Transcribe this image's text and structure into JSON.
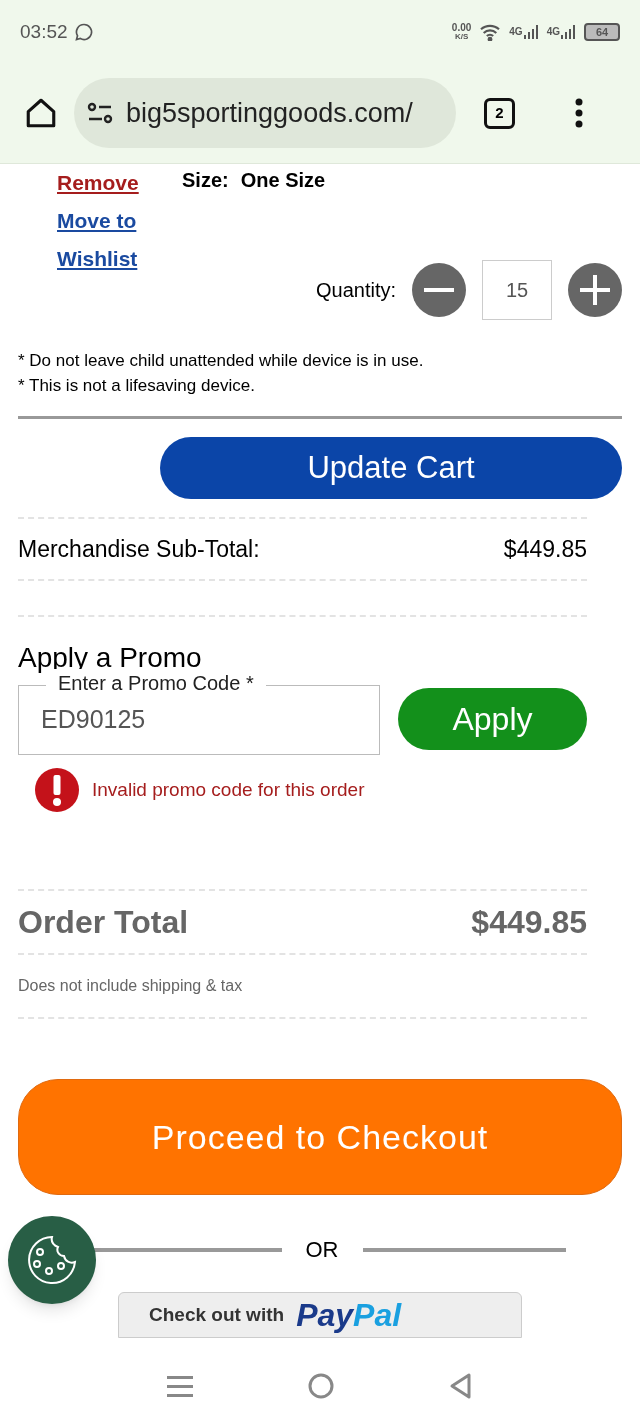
{
  "status_bar": {
    "time": "03:52",
    "net_speed": "0.00",
    "net_unit": "K/S",
    "net_1": "4G",
    "net_2": "4G",
    "battery": "64"
  },
  "browser": {
    "url": "big5sportinggoods.com/",
    "tab_count": "2"
  },
  "item": {
    "actions": [
      {
        "label": "Remove",
        "kind": "danger"
      },
      {
        "label": "Move to Wishlist",
        "kind": "link"
      }
    ],
    "size_label": "Size:",
    "size_value": "One Size",
    "quantity_label": "Quantity:",
    "quantity": "15"
  },
  "notes": [
    "* Do not leave child unattended while device is in use.",
    "* This is not a lifesaving device."
  ],
  "update_button": "Update Cart",
  "subtotal": {
    "label": "Merchandise Sub-Total:",
    "value": "$449.85"
  },
  "promo": {
    "title": "Apply a Promo",
    "field_label": "Enter a Promo Code",
    "required_mark": "*",
    "value": "ED90125",
    "button": "Apply",
    "error": "Invalid promo code for this order"
  },
  "total": {
    "label": "Order Total",
    "value": "$449.85",
    "note": "Does not include shipping & tax"
  },
  "checkout_button": "Proceed to Checkout",
  "or_label": "OR",
  "paypal": {
    "text": "Check out with",
    "brand_1": "Pay",
    "brand_2": "Pal"
  }
}
